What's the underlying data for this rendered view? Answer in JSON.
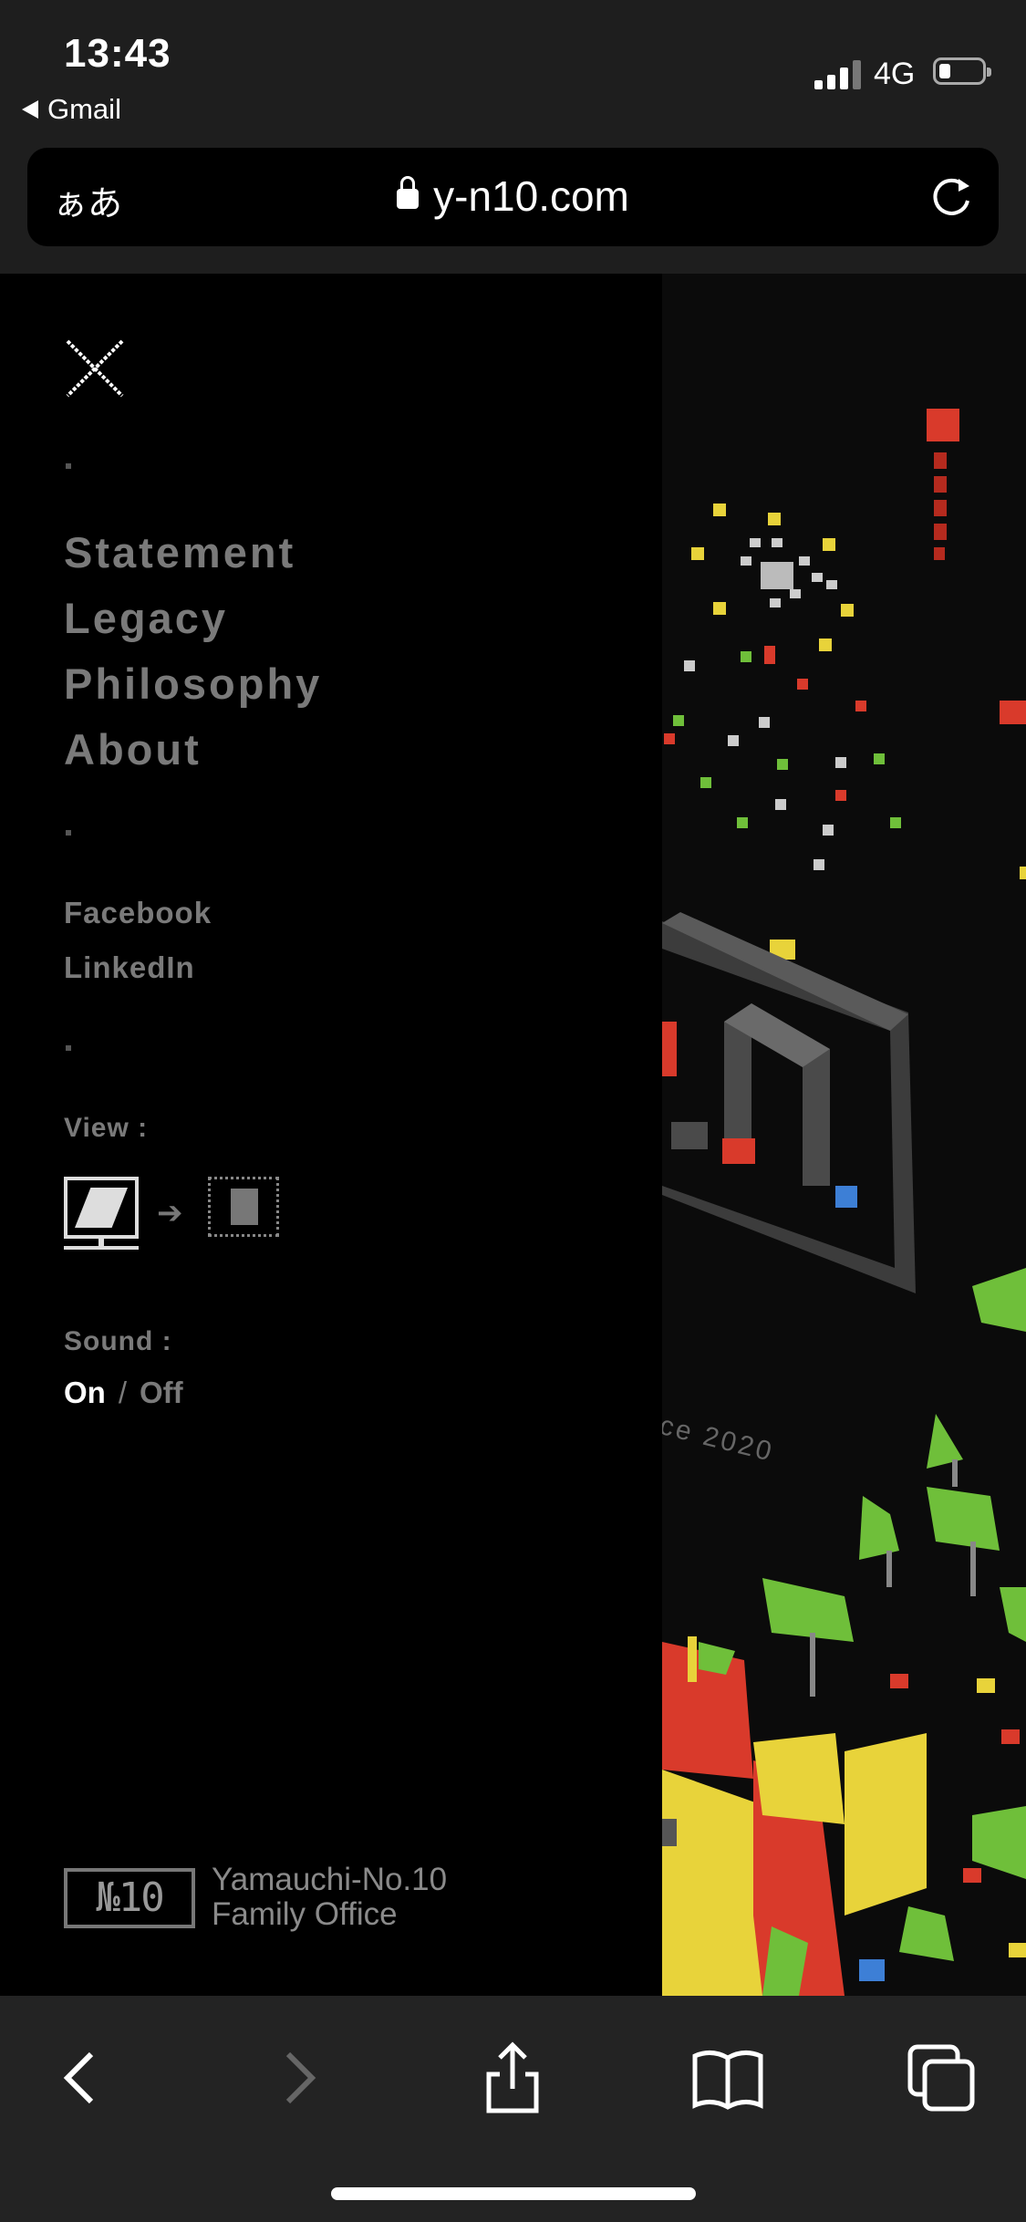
{
  "status_bar": {
    "time": "13:43",
    "back_app": "Gmail",
    "network": "4G",
    "signal_bars": 3
  },
  "browser": {
    "text_size_button": "ぁあ",
    "url": "y-n10.com",
    "icons": [
      "lock-icon",
      "reload-icon",
      "back-icon",
      "forward-icon",
      "share-icon",
      "bookmarks-icon",
      "tabs-icon"
    ]
  },
  "menu": {
    "nav": [
      "Statement",
      "Legacy",
      "Philosophy",
      "About"
    ],
    "social": [
      "Facebook",
      "LinkedIn"
    ],
    "view_label": "View :",
    "sound_label": "Sound :",
    "sound_on": "On",
    "sound_sep": "/",
    "sound_off": "Off",
    "logo_text": "№10",
    "org_line1": "Yamauchi-No.10",
    "org_line2": "Family Office"
  },
  "artwork": {
    "visible_text": "ce 2020",
    "colors": {
      "red": "#d93a2b",
      "yellow": "#e8d33a",
      "green": "#6fbf3a",
      "gray": "#4a4a4a",
      "blue": "#3d7fd6"
    }
  }
}
